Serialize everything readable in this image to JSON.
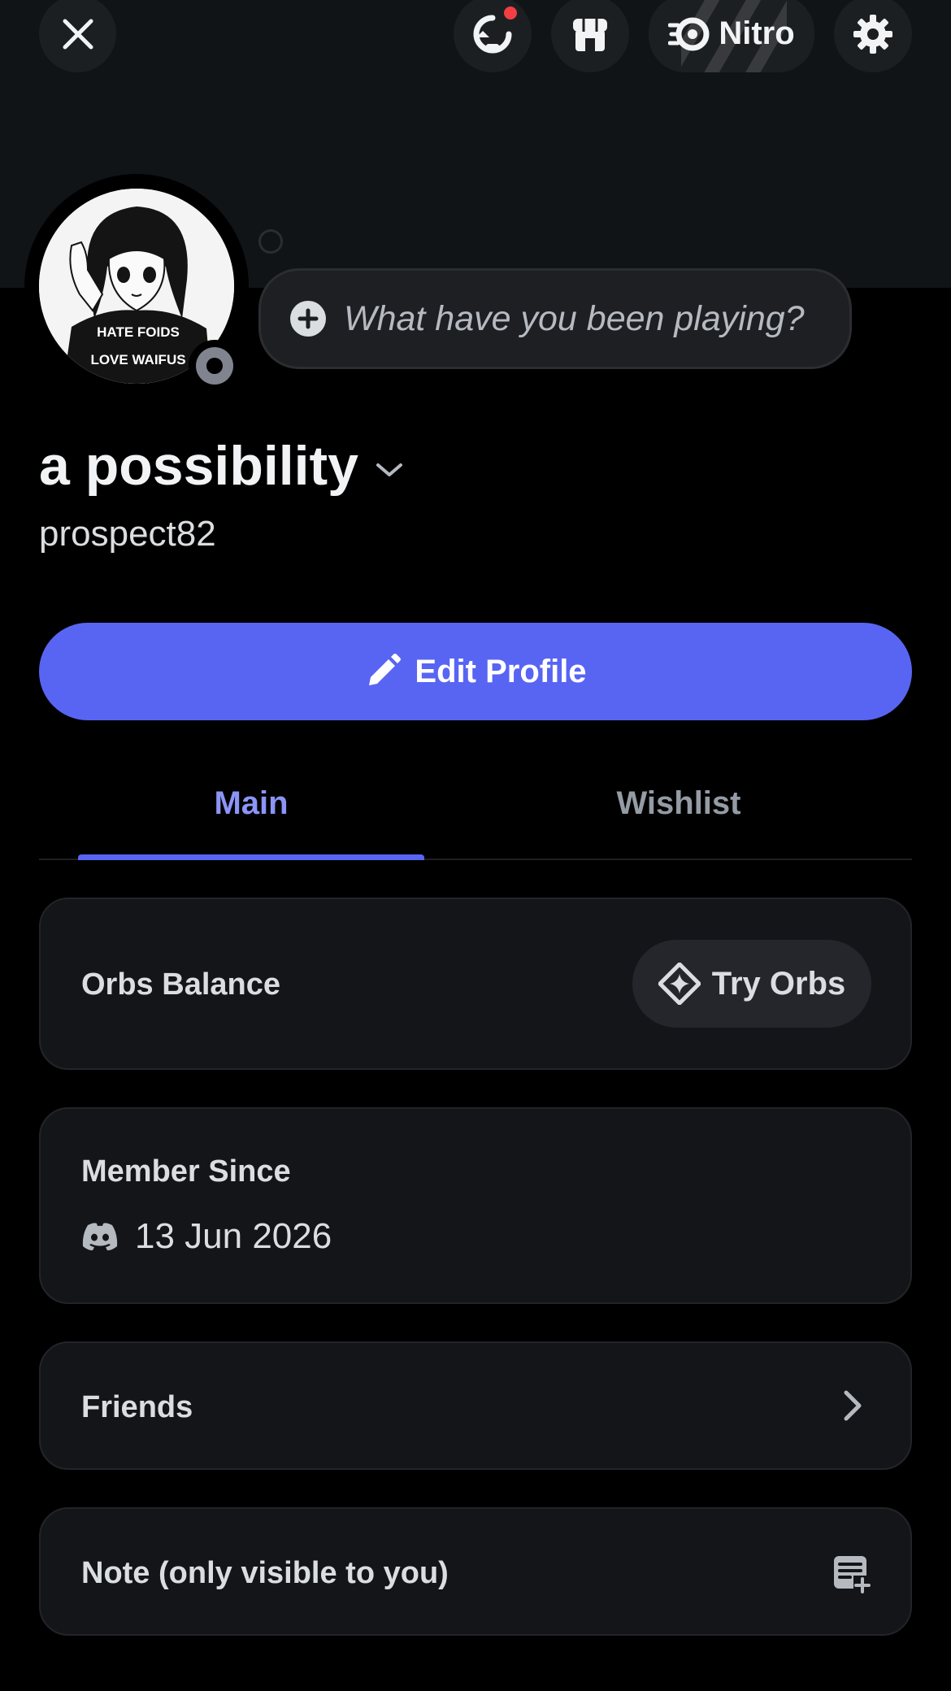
{
  "header": {
    "icons": [
      "close-icon",
      "quests-icon",
      "shop-icon",
      "nitro-icon",
      "gear-icon"
    ],
    "nitro_label": "Nitro",
    "notification_color": "#f23f43"
  },
  "profile": {
    "avatar_text_line1": "HATE FOIDS",
    "avatar_text_line2": "LOVE WAIFUS",
    "activity_placeholder": "What have you been playing?",
    "display_name": "a possibility",
    "username": "prospect82",
    "status": "offline"
  },
  "actions": {
    "edit_profile_label": "Edit Profile",
    "accent_color": "#5865f2"
  },
  "tabs": [
    {
      "label": "Main",
      "active": true
    },
    {
      "label": "Wishlist",
      "active": false
    }
  ],
  "cards": {
    "orbs": {
      "title": "Orbs Balance",
      "button_label": "Try Orbs"
    },
    "member_since": {
      "title": "Member Since",
      "date": "13 Jun 2026"
    },
    "friends": {
      "title": "Friends"
    },
    "note": {
      "title": "Note (only visible to you)"
    }
  }
}
